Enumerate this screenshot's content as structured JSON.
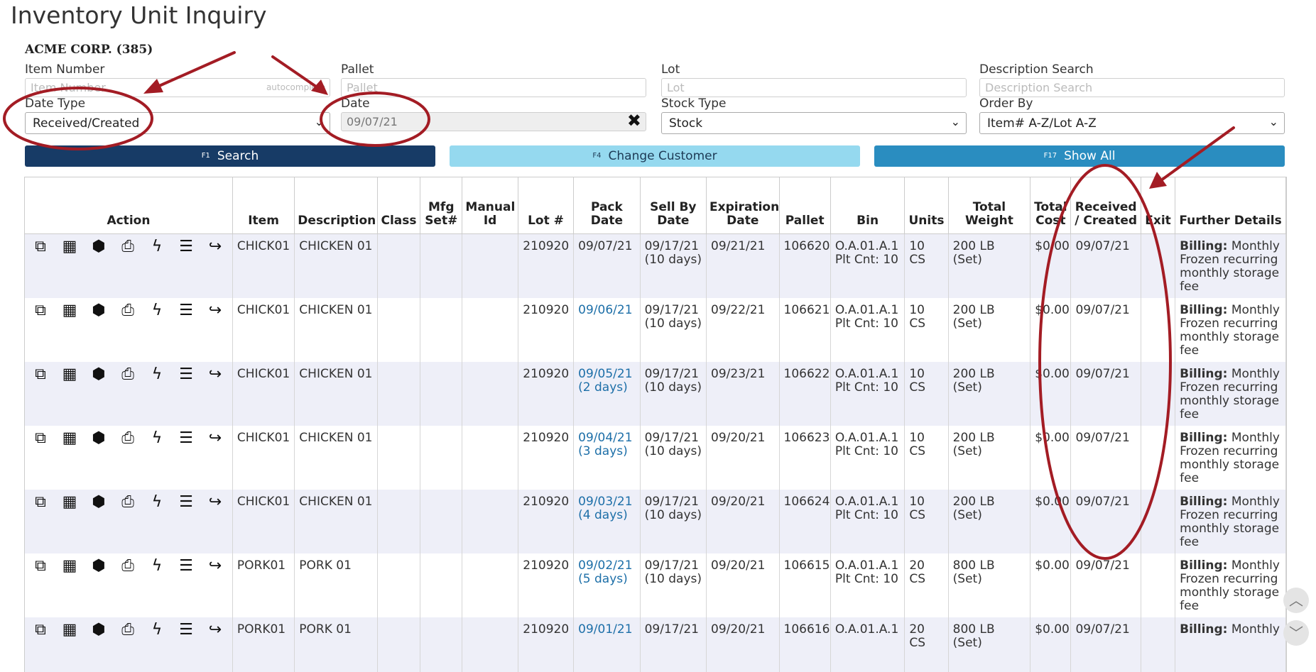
{
  "page": {
    "title": "Inventory Unit Inquiry",
    "company": "ACME CORP. (385)"
  },
  "filters": {
    "item_number": {
      "label": "Item Number",
      "placeholder": "Item Number",
      "tag": "autocomplete"
    },
    "pallet": {
      "label": "Pallet",
      "placeholder": "Pallet"
    },
    "lot": {
      "label": "Lot",
      "placeholder": "Lot"
    },
    "description_search": {
      "label": "Description Search",
      "placeholder": "Description Search"
    },
    "date_type": {
      "label": "Date Type",
      "value": "Received/Created"
    },
    "date": {
      "label": "Date",
      "value": "09/07/21"
    },
    "stock_type": {
      "label": "Stock Type",
      "value": "Stock"
    },
    "order_by": {
      "label": "Order By",
      "value": "Item# A-Z/Lot A-Z"
    }
  },
  "buttons": {
    "search": {
      "key": "F1",
      "label": "Search"
    },
    "change_customer": {
      "key": "F4",
      "label": "Change Customer"
    },
    "show_all": {
      "key": "F17",
      "label": "Show All"
    }
  },
  "table": {
    "headers": {
      "action": "Action",
      "item": "Item",
      "description": "Description",
      "class": "Class",
      "mfg": "Mfg Set#",
      "manual": "Manual Id",
      "lot": "Lot #",
      "pack_date": "Pack Date",
      "sell_by": "Sell By Date",
      "expiration": "Expiration Date",
      "pallet": "Pallet",
      "bin": "Bin",
      "units": "Units",
      "total_weight": "Total Weight",
      "total_cost": "Total Cost",
      "received": "Received / Created",
      "exit": "Exit",
      "further": "Further Details"
    },
    "rows": [
      {
        "item": "CHICK01",
        "description": "CHICKEN 01",
        "class": "",
        "mfg": "",
        "manual": "",
        "lot": "210920",
        "pack_date": "09/07/21",
        "pack_note": "",
        "pack_link": false,
        "sell_by": "09/17/21",
        "sell_note": "(10 days)",
        "expiration": "09/21/21",
        "pallet": "106620",
        "bin": "O.A.01.A.1",
        "plt_cnt": "Plt Cnt: 10",
        "units": "10 CS",
        "weight": "200 LB (Set)",
        "cost": "$0.00",
        "received": "09/07/21",
        "exit": "",
        "billing_label": "Billing:",
        "billing_text": "Monthly Frozen recurring monthly storage fee"
      },
      {
        "item": "CHICK01",
        "description": "CHICKEN 01",
        "class": "",
        "mfg": "",
        "manual": "",
        "lot": "210920",
        "pack_date": "09/06/21",
        "pack_note": "",
        "pack_link": true,
        "sell_by": "09/17/21",
        "sell_note": "(10 days)",
        "expiration": "09/22/21",
        "pallet": "106621",
        "bin": "O.A.01.A.1",
        "plt_cnt": "Plt Cnt: 10",
        "units": "10 CS",
        "weight": "200 LB (Set)",
        "cost": "$0.00",
        "received": "09/07/21",
        "exit": "",
        "billing_label": "Billing:",
        "billing_text": "Monthly Frozen recurring monthly storage fee"
      },
      {
        "item": "CHICK01",
        "description": "CHICKEN 01",
        "class": "",
        "mfg": "",
        "manual": "",
        "lot": "210920",
        "pack_date": "09/05/21",
        "pack_note": "(2 days)",
        "pack_link": true,
        "sell_by": "09/17/21",
        "sell_note": "(10 days)",
        "expiration": "09/23/21",
        "pallet": "106622",
        "bin": "O.A.01.A.1",
        "plt_cnt": "Plt Cnt: 10",
        "units": "10 CS",
        "weight": "200 LB (Set)",
        "cost": "$0.00",
        "received": "09/07/21",
        "exit": "",
        "billing_label": "Billing:",
        "billing_text": "Monthly Frozen recurring monthly storage fee"
      },
      {
        "item": "CHICK01",
        "description": "CHICKEN 01",
        "class": "",
        "mfg": "",
        "manual": "",
        "lot": "210920",
        "pack_date": "09/04/21",
        "pack_note": "(3 days)",
        "pack_link": true,
        "sell_by": "09/17/21",
        "sell_note": "(10 days)",
        "expiration": "09/20/21",
        "pallet": "106623",
        "bin": "O.A.01.A.1",
        "plt_cnt": "Plt Cnt: 10",
        "units": "10 CS",
        "weight": "200 LB (Set)",
        "cost": "$0.00",
        "received": "09/07/21",
        "exit": "",
        "billing_label": "Billing:",
        "billing_text": "Monthly Frozen recurring monthly storage fee"
      },
      {
        "item": "CHICK01",
        "description": "CHICKEN 01",
        "class": "",
        "mfg": "",
        "manual": "",
        "lot": "210920",
        "pack_date": "09/03/21",
        "pack_note": "(4 days)",
        "pack_link": true,
        "sell_by": "09/17/21",
        "sell_note": "(10 days)",
        "expiration": "09/20/21",
        "pallet": "106624",
        "bin": "O.A.01.A.1",
        "plt_cnt": "Plt Cnt: 10",
        "units": "10 CS",
        "weight": "200 LB (Set)",
        "cost": "$0.00",
        "received": "09/07/21",
        "exit": "",
        "billing_label": "Billing:",
        "billing_text": "Monthly Frozen recurring monthly storage fee"
      },
      {
        "item": "PORK01",
        "description": "PORK 01",
        "class": "",
        "mfg": "",
        "manual": "",
        "lot": "210920",
        "pack_date": "09/02/21",
        "pack_note": "(5 days)",
        "pack_link": true,
        "sell_by": "09/17/21",
        "sell_note": "(10 days)",
        "expiration": "09/20/21",
        "pallet": "106615",
        "bin": "O.A.01.A.1",
        "plt_cnt": "Plt Cnt: 10",
        "units": "20 CS",
        "weight": "800 LB (Set)",
        "cost": "$0.00",
        "received": "09/07/21",
        "exit": "",
        "billing_label": "Billing:",
        "billing_text": "Monthly Frozen recurring monthly storage fee"
      },
      {
        "item": "PORK01",
        "description": "PORK 01",
        "class": "",
        "mfg": "",
        "manual": "",
        "lot": "210920",
        "pack_date": "09/01/21",
        "pack_note": "",
        "pack_link": true,
        "sell_by": "09/17/21",
        "sell_note": "",
        "expiration": "09/20/21",
        "pallet": "106616",
        "bin": "O.A.01.A.1",
        "plt_cnt": "",
        "units": "20 CS",
        "weight": "800 LB (Set)",
        "cost": "$0.00",
        "received": "09/07/21",
        "exit": "",
        "billing_label": "Billing:",
        "billing_text": "Monthly"
      }
    ]
  },
  "action_icons": [
    {
      "name": "open-external-icon",
      "glyph": "⧉"
    },
    {
      "name": "pallets-icon",
      "glyph": "▦"
    },
    {
      "name": "box-icon",
      "glyph": "⬢"
    },
    {
      "name": "print-icon",
      "glyph": "⎙"
    },
    {
      "name": "lightning-icon",
      "glyph": "ϟ"
    },
    {
      "name": "list-icon",
      "glyph": "☰"
    },
    {
      "name": "share-icon",
      "glyph": "↪"
    }
  ],
  "colors": {
    "search_button": "#173b66",
    "change_customer_button": "#95d9ef",
    "show_all_button": "#2a8dc0",
    "row_stripe": "#eeeff8",
    "annotation": "#a31c24",
    "link": "#1d6fa8"
  }
}
